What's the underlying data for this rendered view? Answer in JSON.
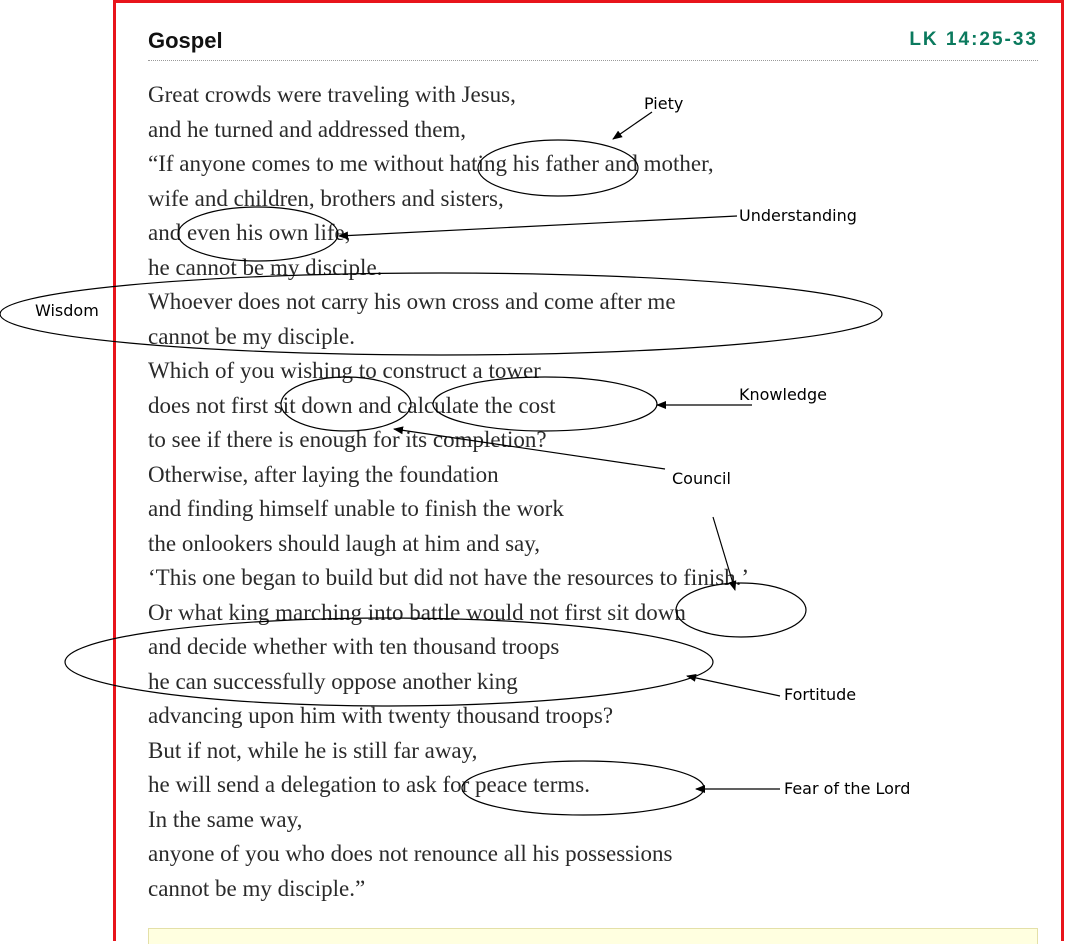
{
  "header": {
    "title": "Gospel",
    "reference": "LK 14:25-33",
    "reference_color": "#0b7a5e"
  },
  "verses": [
    "Great crowds were traveling with Jesus,",
    "and he turned and addressed them,",
    "“If anyone comes to me without hating his father and mother,",
    "wife and children, brothers and sisters,",
    "and even his own life,",
    "he cannot be my disciple.",
    "Whoever does not carry his own cross and come after me",
    "cannot be my disciple.",
    "Which of you wishing to construct a tower",
    "does not first sit down and calculate the cost",
    "to see if there is enough for its completion?",
    "Otherwise, after laying the foundation",
    "and finding himself unable to finish the work",
    "the onlookers should laugh at him and say,",
    "‘This one began to build but did not have the resources to finish.’",
    "Or what king marching into battle would not first sit down",
    "and decide whether with ten thousand troops",
    "he can successfully oppose another king",
    "advancing upon him with twenty thousand troops?",
    "But if not, while he is still far away,",
    "he will send a delegation to ask for peace terms.",
    "In the same way,",
    "anyone of you who does not renounce all his possessions",
    "cannot be my disciple.”"
  ],
  "annotations": {
    "piety": "Piety",
    "understanding": "Understanding",
    "wisdom": "Wisdom",
    "knowledge": "Knowledge",
    "council": "Council",
    "fortitude": "Fortitude",
    "fear_of_the_lord": "Fear of the Lord"
  },
  "colors": {
    "frame_border": "#e8141b",
    "text": "#2a2a2a"
  }
}
